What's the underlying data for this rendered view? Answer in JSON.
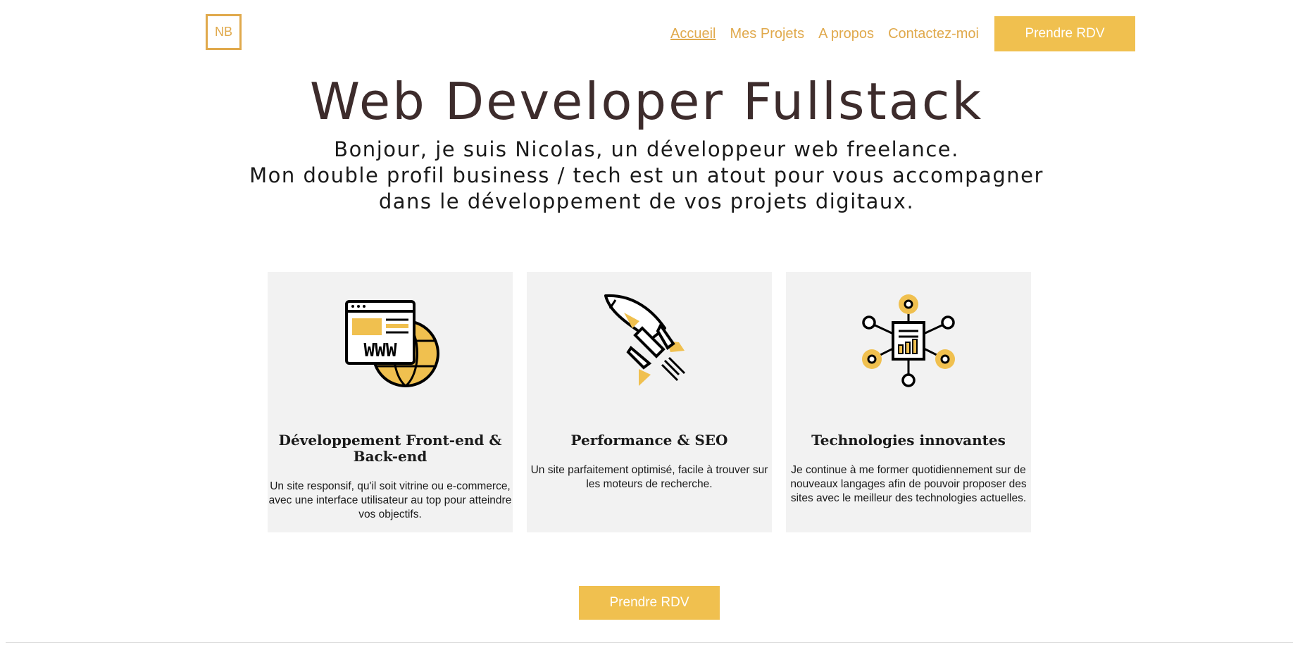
{
  "logo": {
    "text": "NB"
  },
  "nav": {
    "items": [
      {
        "label": "Accueil",
        "active": true
      },
      {
        "label": "Mes Projets"
      },
      {
        "label": "A propos"
      },
      {
        "label": "Contactez-moi"
      }
    ],
    "cta_label": "Prendre RDV"
  },
  "hero": {
    "title": "Web Developer Fullstack",
    "subtitle_lines": [
      "Bonjour, je suis Nicolas, un développeur web freelance.",
      "Mon double profil business / tech est un atout pour vous accompagner",
      "dans le développement de vos projets digitaux."
    ]
  },
  "cards": [
    {
      "icon": "globe-www-icon",
      "title": "Développement Front-end & Back-end",
      "text": "Un site responsif, qu'il soit vitrine ou e-commerce, avec une interface utilisateur au top pour atteindre vos objectifs."
    },
    {
      "icon": "rocket-icon",
      "title": "Performance & SEO",
      "text": "Un site parfaitement optimisé, facile à trouver sur les moteurs de recherche."
    },
    {
      "icon": "network-icon",
      "title": "Technologies innovantes",
      "text": "Je continue à me former quotidiennement sur de nouveaux langages afin de pouvoir proposer des sites avec le meilleur des technologies actuelles."
    }
  ],
  "cta_bottom": {
    "label": "Prendre RDV"
  },
  "colors": {
    "accent": "#f0c04f",
    "accent_text": "#e0a94c",
    "title": "#3d2c2c",
    "card_bg": "#f2f2f2"
  }
}
